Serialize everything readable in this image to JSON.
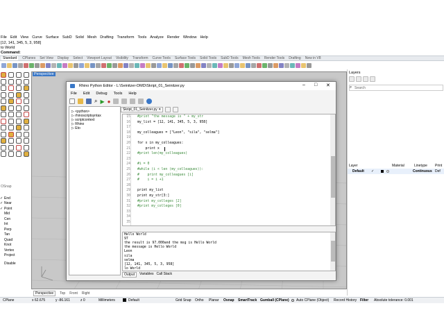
{
  "menubar": [
    "File",
    "Edit",
    "View",
    "Curve",
    "Surface",
    "SubD",
    "Solid",
    "Mesh",
    "Drafting",
    "Transform",
    "Tools",
    "Analyze",
    "Render",
    "Window",
    "Help"
  ],
  "command_history": [
    "[12, 141, 345, 5, 3, 958]",
    "to World"
  ],
  "command_label": "Command:",
  "top_tabs": [
    "Standard",
    "CPlanes",
    "Set View",
    "Display",
    "Select",
    "Viewport Layout",
    "Visibility",
    "Transform",
    "Curve Tools",
    "Surface Tools",
    "Solid Tools",
    "SubD Tools",
    "Mesh Tools",
    "Render Tools",
    "Drafting",
    "New in V8"
  ],
  "viewport": {
    "title": "Perspective"
  },
  "osnap": {
    "title": "OSnap",
    "items": [
      {
        "label": "End",
        "checked": true
      },
      {
        "label": "Near",
        "checked": true
      },
      {
        "label": "Point",
        "checked": true
      },
      {
        "label": "Mid",
        "checked": false
      },
      {
        "label": "Cen",
        "checked": false
      },
      {
        "label": "Int",
        "checked": false
      },
      {
        "label": "Perp",
        "checked": false
      },
      {
        "label": "Tan",
        "checked": false
      },
      {
        "label": "Quad",
        "checked": false
      },
      {
        "label": "Knot",
        "checked": false
      },
      {
        "label": "Vertex",
        "checked": false
      },
      {
        "label": "Project",
        "checked": false
      }
    ],
    "disable": "Disable"
  },
  "layers": {
    "title": "Layers",
    "search_placeholder": "Search",
    "headers": {
      "layer": "Layer",
      "material": "Material",
      "linetype": "Linetype",
      "print": "Print"
    },
    "row": {
      "name": "Default",
      "linetype": "Continuous",
      "print": "Def"
    }
  },
  "bottom_tabs": [
    "Perspective",
    "Top",
    "Front",
    "Right"
  ],
  "status": {
    "cplane": "CPlane",
    "x": "x 62.675",
    "y": "y -86.161",
    "z": "z 0",
    "units": "Millimeters",
    "layer": "Default",
    "grid_snap": "Grid Snap",
    "ortho": "Ortho",
    "planar": "Planar",
    "osnap": "Osnap",
    "smarttrack": "SmartTrack",
    "gumball": "Gumball (CPlane)",
    "autocplane": "Auto CPlane (Object)",
    "record": "Record History",
    "filter": "Filter",
    "tolerance": "Absolute tolerance: 0.001"
  },
  "editor": {
    "title": "Rhino Python Editor - L:\\Seinitzer-DMD\\Skript_01_Seinitzer.py",
    "menu": [
      "File",
      "Edit",
      "Debug",
      "Tools",
      "Help"
    ],
    "tab_label": "Skript_01_Seinitzer.py",
    "tree": [
      "<python>",
      "rhinoscriptsyntax",
      "scriptcontext",
      "Rhino",
      "Eto"
    ],
    "line_numbers": [
      "15",
      "16",
      "17",
      "18",
      "19",
      "20",
      "21",
      "22",
      "23",
      "24",
      "25",
      "26",
      "27",
      "28",
      "29",
      "30",
      "31",
      "32",
      "33",
      "34",
      "35"
    ],
    "code": [
      {
        "t": "#print \"the message is \" + my_str",
        "c": "#3a8a3a"
      },
      {
        "t": "my_list = [12, 141, 345, 5, 3, 958]",
        "c": "#000000"
      },
      {
        "t": "",
        "c": "#000000"
      },
      {
        "t": "my_colleagues = [\"Leon\", \"sila\", \"selma\"]",
        "c": "#000000"
      },
      {
        "t": "",
        "c": "#000000"
      },
      {
        "t": "for x in my_colleagues:",
        "c": "#000000"
      },
      {
        "t": "    print x",
        "c": "#000000"
      },
      {
        "t": "#print len(my_colleagues)",
        "c": "#3a8a3a"
      },
      {
        "t": "",
        "c": "#000000"
      },
      {
        "t": "#i = 0",
        "c": "#3a8a3a"
      },
      {
        "t": "#while (i < len (my_colleagues)):",
        "c": "#3a8a3a"
      },
      {
        "t": "#    print my_colleagues [i]",
        "c": "#3a8a3a"
      },
      {
        "t": "#    i = i +1",
        "c": "#3a8a3a"
      },
      {
        "t": "",
        "c": "#000000"
      },
      {
        "t": "print my_list",
        "c": "#000000"
      },
      {
        "t": "print my_str[3:]",
        "c": "#000000"
      },
      {
        "t": "#print my_colleges [2]",
        "c": "#3a8a3a"
      },
      {
        "t": "#print my_colleges [0]",
        "c": "#3a8a3a"
      },
      {
        "t": "",
        "c": "#000000"
      },
      {
        "t": "",
        "c": "#000000"
      },
      {
        "t": "",
        "c": "#000000"
      }
    ],
    "output": [
      "Hello World",
      "97",
      "the result is 97.000and the msg is Hello World",
      "the message is Hello World",
      "Leon",
      "sila",
      "selma",
      "[12, 141, 345, 5, 3, 958]",
      "lo World"
    ],
    "output_tabs": [
      "Output",
      "Variables",
      "Call Stack"
    ]
  },
  "colors": {
    "accent": "#3a78c8",
    "comment": "#3a8a3a",
    "viewport_bg": "#c8c8c8"
  }
}
